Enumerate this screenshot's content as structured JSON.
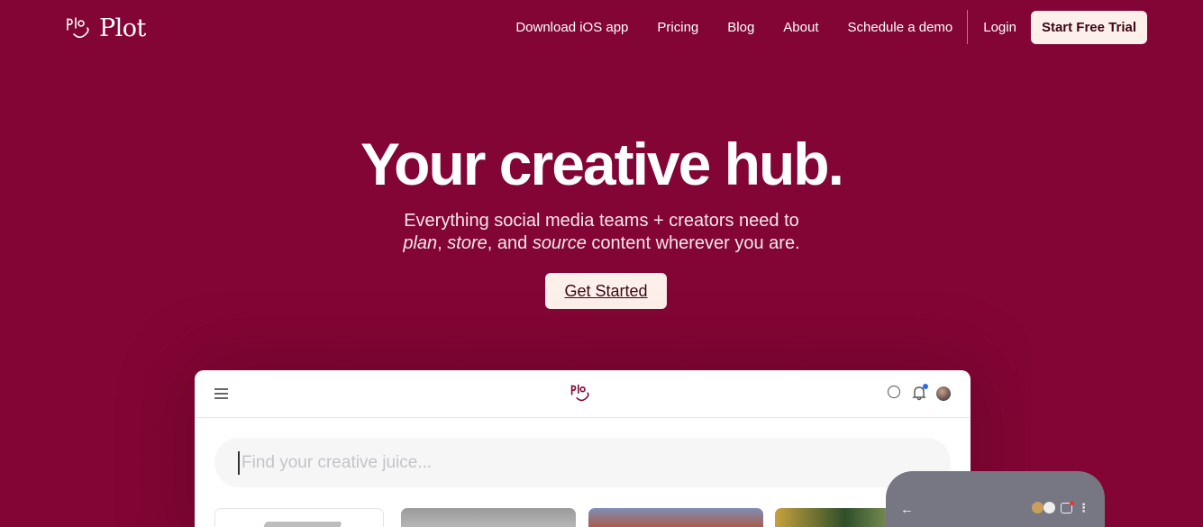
{
  "brand": {
    "name": "Plot",
    "logo_icon": "plot-logo-icon",
    "color": "#820535"
  },
  "nav": {
    "items": [
      {
        "label": "Download iOS app"
      },
      {
        "label": "Pricing"
      },
      {
        "label": "Blog"
      },
      {
        "label": "About"
      },
      {
        "label": "Schedule a demo"
      }
    ],
    "login_label": "Login",
    "trial_label": "Start Free Trial"
  },
  "hero": {
    "title": "Your creative hub.",
    "subtitle_line1": "Everything social media teams + creators need to",
    "subtitle_word_plan": "plan",
    "subtitle_sep1": ", ",
    "subtitle_word_store": "store",
    "subtitle_sep2": ", and ",
    "subtitle_word_source": "source",
    "subtitle_tail": " content wherever you are.",
    "cta_label": "Get Started"
  },
  "app_mockup": {
    "search_placeholder": "Find your creative juice...",
    "icons": [
      "menu-icon",
      "plot-logo-icon",
      "search-icon",
      "bell-icon",
      "avatar"
    ]
  },
  "phone_mockup": {
    "back_glyph": "←",
    "more_glyph": "⋮"
  }
}
